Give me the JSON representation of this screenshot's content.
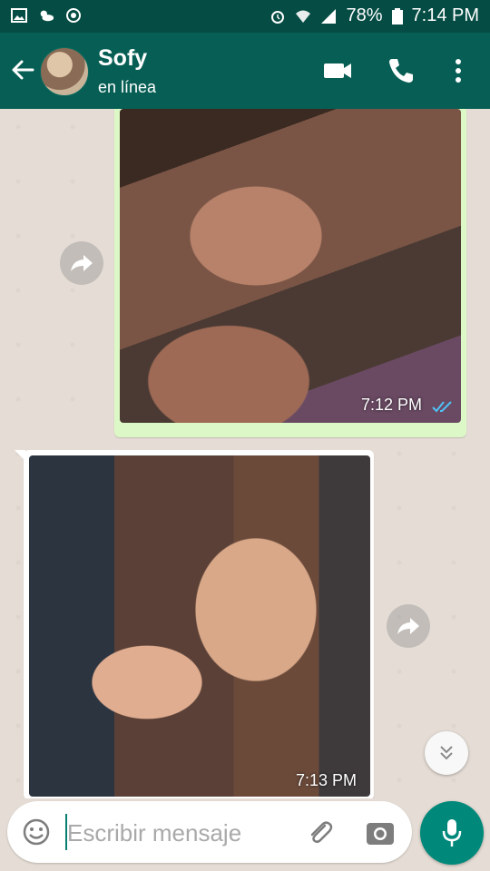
{
  "status_bar": {
    "battery": "78%",
    "time": "7:14 PM",
    "icons": [
      "image-icon",
      "weather-icon",
      "whatsapp-icon",
      "alarm-icon",
      "wifi-icon",
      "signal-icon",
      "battery-icon"
    ]
  },
  "header": {
    "contact_name": "Sofy",
    "status": "en línea",
    "icons": [
      "back-arrow-icon",
      "avatar",
      "video-call-icon",
      "phone-icon",
      "more-vert-icon"
    ],
    "bar_color": "#075e54",
    "status_bar_color": "#054d44"
  },
  "messages": [
    {
      "direction": "outgoing",
      "type": "image",
      "time": "7:12 PM",
      "read": true,
      "bubble_color": "#dcf8c6"
    },
    {
      "direction": "incoming",
      "type": "image",
      "time": "7:13 PM",
      "bubble_color": "#ffffff"
    }
  ],
  "composer": {
    "placeholder": "Escribir mensaje",
    "value": "",
    "icons": [
      "emoji-icon",
      "attach-icon",
      "camera-icon",
      "mic-icon"
    ],
    "accent_color": "#00897b"
  },
  "colors": {
    "chat_background": "#e5ddd5",
    "read_ticks": "#4fc3f7"
  }
}
